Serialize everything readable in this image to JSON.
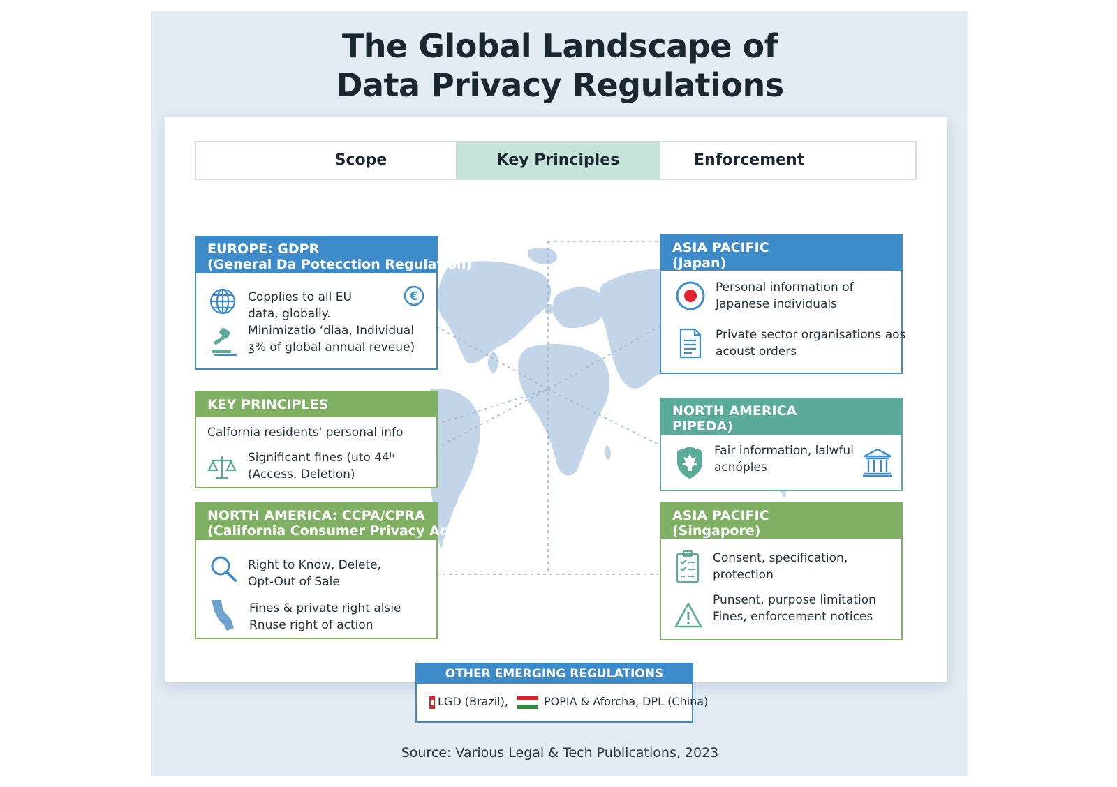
{
  "title": {
    "line1": "The Global Landscape of",
    "line2": "Data Privacy Regulations"
  },
  "tabs": [
    {
      "label": "Scope",
      "active": false
    },
    {
      "label": "Key Principles",
      "active": true
    },
    {
      "label": "Enforcement",
      "active": false
    }
  ],
  "cards": {
    "europe": {
      "header1": "EUROPE: GDPR",
      "header2": "(General Da Potecction Regulation)",
      "row1_line1": "Copplies to all EU",
      "row1_line2": "data, globally.",
      "row2_line1": "Minimizatio​\t ​ʻdlaa, Individual",
      "row2_line2": "ʒ% of global annual reveue)",
      "icons": [
        "globe-icon",
        "euro-icon",
        "gavel-icon"
      ]
    },
    "key_principles": {
      "header1": "KEY PRINCIPLES",
      "row1": "Calfornia residents' personal info",
      "row2_line1": "Significant fines (uto 4​4​ʰ",
      "row2_line2": "(Access, Deletion)",
      "icons": [
        "scales-icon"
      ]
    },
    "ccpa": {
      "header1": "NORTH AMERICA: CCPA/CPRA",
      "header2": "(California Consumer Privacy Act)",
      "row1_line1": "Right to Know, Delete,",
      "row1_line2": "Opt-Out of Sale",
      "row2_line1": "Fines & private right alsie",
      "row2_line2": "Rnuse right of action",
      "icons": [
        "magnifier-icon",
        "california-shape-icon"
      ]
    },
    "japan": {
      "header1": "ASIA PACIFIC",
      "header2": "(Japan)",
      "row1_line1": "Personal information of",
      "row1_line2": "Japanese individuals",
      "row2_line1": "Private sector organisations aos",
      "row2_line2": "acoust orders",
      "icons": [
        "japan-flag-icon",
        "document-icon"
      ]
    },
    "pipeda": {
      "header1": "NORTH AMERICA",
      "header2": "PIPEDA)",
      "row1_line1": "Fair information, lalwful",
      "row1_line2": "acnóples",
      "icons": [
        "maple-shield-icon",
        "courthouse-icon"
      ]
    },
    "singapore": {
      "header1": "ASIA PACIFIC",
      "header2": "(Singapore)",
      "row1_line1": "Consent, specification,",
      "row1_line2": "protection",
      "row2_line1": "Punsent, purpose limitation",
      "row2_line2": "Fines, enforcement notices",
      "icons": [
        "checklist-icon",
        "warning-icon"
      ]
    }
  },
  "emerging": {
    "header": "OTHER EMERGING REGULATIONS",
    "item1": "LGD (Brazil),",
    "item2": "POPIA & Aforcha, DPL (China)",
    "icons": [
      "brazil-flag-icon",
      "flag-icon"
    ]
  },
  "source": "Source: Various Legal & Tech Publications, 2023",
  "colors": {
    "blue": "#3d8bc9",
    "green": "#7fb063",
    "teal": "#5aab97",
    "active_tab": "#c6e4d9",
    "map": "#c3d5e8",
    "background": "#e3ebf4"
  }
}
